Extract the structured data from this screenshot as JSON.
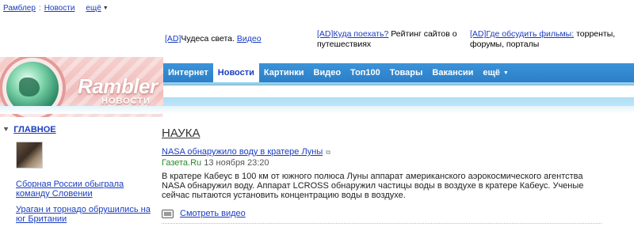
{
  "topnav": {
    "rambler": "Рамблер",
    "separator": ":",
    "news": "Новости",
    "more": "ещё"
  },
  "ads": [
    {
      "tag": "[AD]",
      "text": "Чудеса света.",
      "link": "Видео",
      "rest": ""
    },
    {
      "tag": "[AD]",
      "link": "Куда поехать?",
      "text": " Рейтинг сайтов о путешествиях",
      "rest": ""
    },
    {
      "tag": "[AD]",
      "link": "Где обсудить фильмы:",
      "text": " торренты, форумы, порталы",
      "rest": ""
    }
  ],
  "header": {
    "brand": "Rambler",
    "brand_sub": "НОВОСТИ",
    "menu": [
      {
        "label": "Интернет",
        "active": false
      },
      {
        "label": "Новости",
        "active": true
      },
      {
        "label": "Картинки",
        "active": false
      },
      {
        "label": "Видео",
        "active": false
      },
      {
        "label": "Топ100",
        "active": false
      },
      {
        "label": "Товары",
        "active": false
      },
      {
        "label": "Вакансии",
        "active": false
      },
      {
        "label": "ещё",
        "active": false
      }
    ]
  },
  "sidebar": {
    "heading": "ГЛАВНОЕ",
    "news": [
      "Сборная России обыграла команду Словении",
      "Ураган и торнадо обрушились на юг Британии"
    ]
  },
  "main": {
    "section": "НАУКА",
    "article_title": "NASA обнаружило воду в кратере Луны",
    "source": "Газета.Ru",
    "date": "13 ноября 23:20",
    "body": "В кратере Кабеус в 100 км от южного полюса Луны аппарат американского аэрокосмического агентства NASA обнаружил воду. Аппарат LCROSS обнаружил частицы воды в воздухе в кратере Кабеус. Ученые сейчас пытаются установить концентрацию воды в воздухе.",
    "video_link": "Смотреть видео"
  },
  "colors": {
    "link": "#1a3dc1",
    "menubar": "#2b7fc7",
    "source": "#2a8a2a"
  }
}
